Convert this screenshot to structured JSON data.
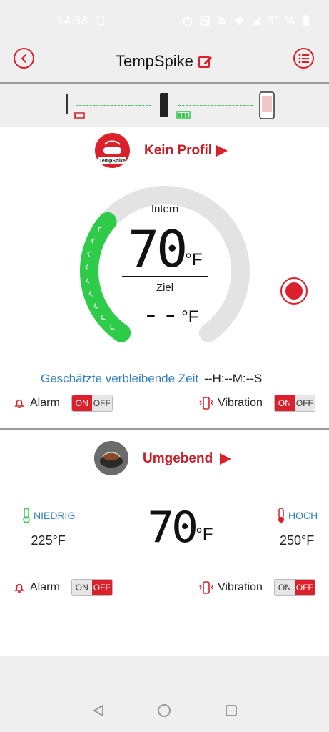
{
  "status": {
    "time": "14:38",
    "battery": "51 %"
  },
  "header": {
    "title": "TempSpike"
  },
  "probe": {
    "profile_name": "Kein Profil",
    "logo_text": "TempSpike",
    "internal_label": "Intern",
    "internal_temp": "70",
    "internal_unit": "°F",
    "target_label": "Ziel",
    "target_temp": "--",
    "target_unit": "°F",
    "remaining_label": "Geschätzte verbleibende Zeit",
    "remaining_value": "--H:--M:--S",
    "alarm_label": "Alarm",
    "alarm_state": "ON",
    "vibration_label": "Vibration",
    "vibration_state": "ON",
    "toggle_on": "ON",
    "toggle_off": "OFF",
    "gauge_fraction": 0.33
  },
  "ambient": {
    "name": "Umgebend",
    "low_label": "NIEDRIG",
    "low_value": "225°F",
    "high_label": "HOCH",
    "high_value": "250°F",
    "temp": "70",
    "unit": "°F",
    "alarm_label": "Alarm",
    "alarm_state": "OFF",
    "vibration_label": "Vibration",
    "vibration_state": "OFF",
    "toggle_on": "ON",
    "toggle_off": "OFF"
  },
  "colors": {
    "accent": "#d9202b",
    "gauge_active": "#2ecc48",
    "gauge_track": "#e3e3e3",
    "link_blue": "#2f7fc1",
    "connection": "#3cc44f"
  }
}
